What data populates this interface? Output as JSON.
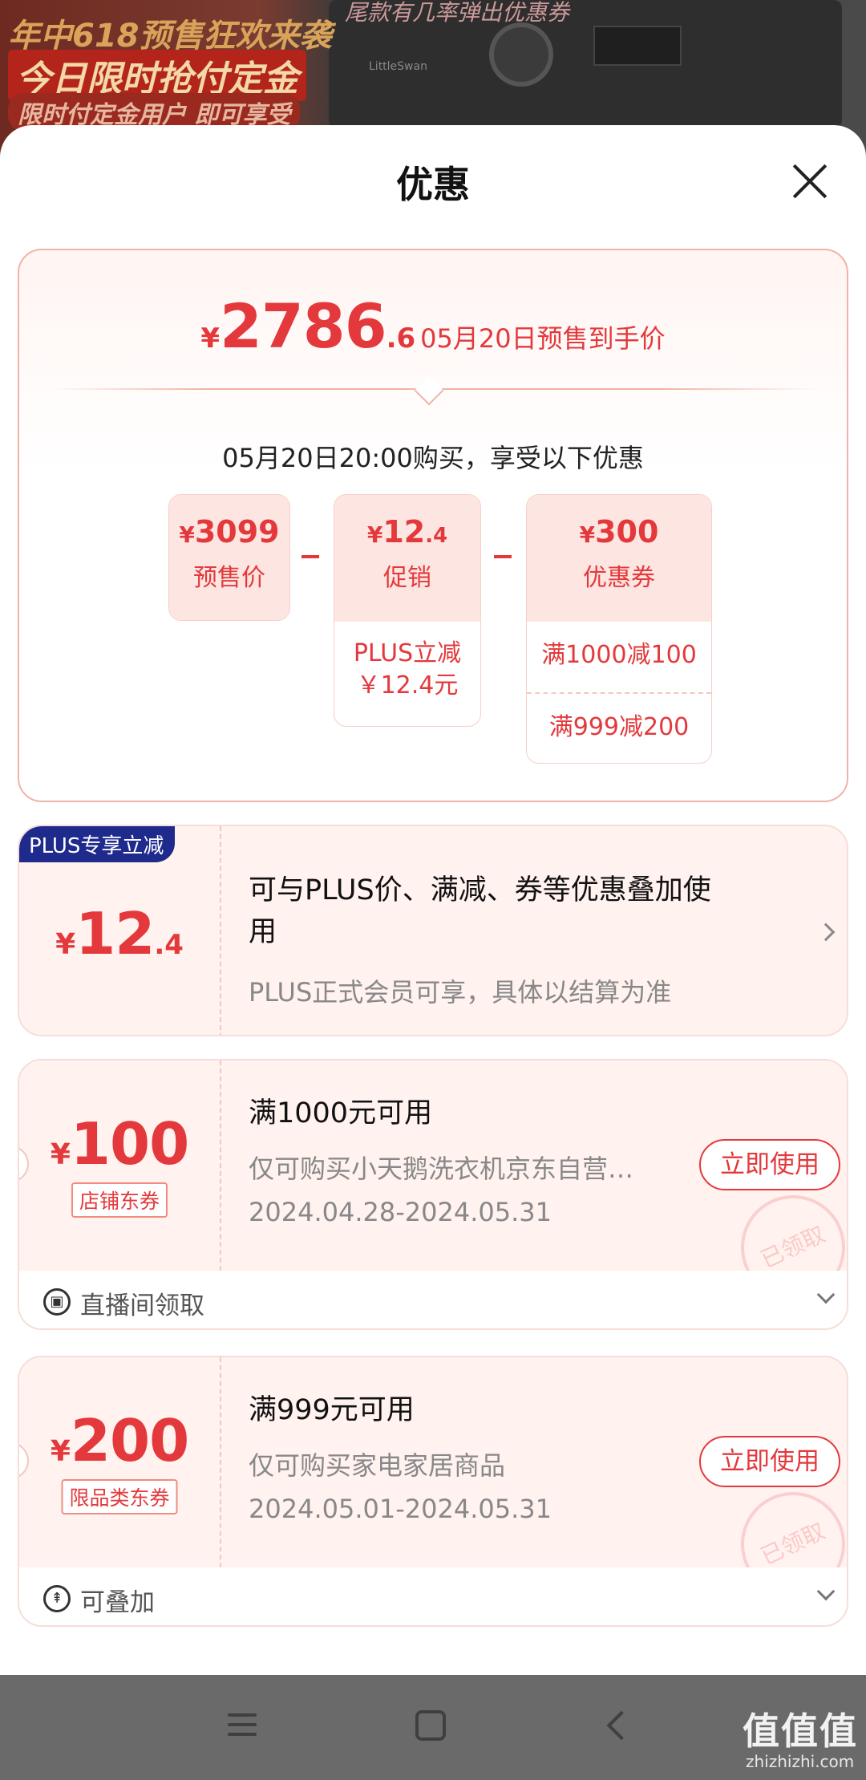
{
  "banner": {
    "line1": "年中618预售狂欢来袭",
    "line2": "今日限时抢付定金",
    "line3": "限时付定金用户 即可享受",
    "top_right": "尾款有几率弹出优惠券"
  },
  "sheet": {
    "title": "优惠"
  },
  "summary": {
    "price_symbol": "¥",
    "price_int": "2786",
    "price_dec": ".6",
    "price_label": "05月20日预售到手价",
    "buy_time": "05月20日20:00购买，享受以下优惠",
    "presale": {
      "symbol": "¥",
      "value": "3099",
      "name": "预售价"
    },
    "promo": {
      "symbol": "¥",
      "value": "12",
      "dec": ".4",
      "name": "促销",
      "details": [
        "PLUS立减",
        "￥12.4元"
      ]
    },
    "coupon": {
      "symbol": "¥",
      "value": "300",
      "name": "优惠券",
      "details": [
        "满1000减100",
        "满999减200"
      ]
    }
  },
  "plus_card": {
    "badge": "PLUS专享立减",
    "symbol": "¥",
    "value": "12",
    "dec": ".4",
    "title": "可与PLUS价、满减、券等优惠叠加使用",
    "subtitle": "PLUS正式会员可享，具体以结算为准"
  },
  "coupons": [
    {
      "symbol": "¥",
      "value": "100",
      "tag": "店铺东券",
      "title": "满1000元可用",
      "desc": "仅可购买小天鹅洗衣机京东自营…",
      "period": "2024.04.28-2024.05.31",
      "button": "立即使用",
      "stamp": "已领取",
      "footer": "直播间领取"
    },
    {
      "symbol": "¥",
      "value": "200",
      "tag": "限品类东券",
      "title": "满999元可用",
      "desc": "仅可购买家电家居商品",
      "period": "2024.05.01-2024.05.31",
      "button": "立即使用",
      "stamp": "已领取",
      "footer": "可叠加"
    }
  ],
  "watermark": {
    "brand": "值值值",
    "url": "zhizhizhi.com"
  },
  "colors": {
    "accent": "#e4393c",
    "plus_badge": "#1e2a8c",
    "card_tint": "#fff2ef"
  }
}
